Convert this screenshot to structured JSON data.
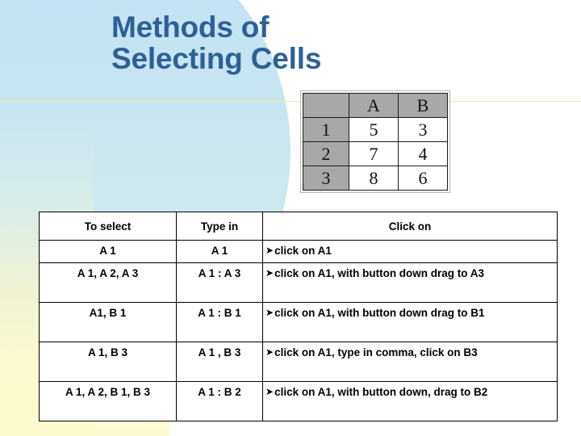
{
  "slide": {
    "title": "Methods of\nSelecting Cells",
    "title_color": "#2e6095",
    "background_accent_color": "#c6e4f3",
    "background_wash_color": "#fdface",
    "rule_color": "#f0e6a8"
  },
  "spreadsheet_image": {
    "column_headers": [
      "",
      "A",
      "B"
    ],
    "rows": [
      {
        "row_header": "1",
        "cells": [
          "5",
          "3"
        ]
      },
      {
        "row_header": "2",
        "cells": [
          "7",
          "4"
        ]
      },
      {
        "row_header": "3",
        "cells": [
          "8",
          "6"
        ]
      }
    ],
    "header_bg": "#a8a8a8"
  },
  "methods_table": {
    "headers": [
      "To select",
      "Type in",
      "Click on"
    ],
    "bullet_glyph": "➤",
    "rows": [
      {
        "select": "A 1",
        "type_in": "A 1",
        "click_on": "click on A1"
      },
      {
        "select": "A 1,  A 2,  A 3",
        "type_in": "A 1 :  A 3",
        "click_on": "click on A1, with button down drag to A3"
      },
      {
        "select": "A1,  B 1",
        "type_in": "A 1 :  B 1",
        "click_on": "click on A1, with button down drag to B1"
      },
      {
        "select": "A 1,  B 3",
        "type_in": "A 1 ,  B 3",
        "click_on": "click on A1, type in comma, click on B3"
      },
      {
        "select": "A 1,  A 2,  B 1,  B 3",
        "type_in": "A 1 :  B 2",
        "click_on": "click on A1, with button down, drag to B2"
      }
    ]
  }
}
